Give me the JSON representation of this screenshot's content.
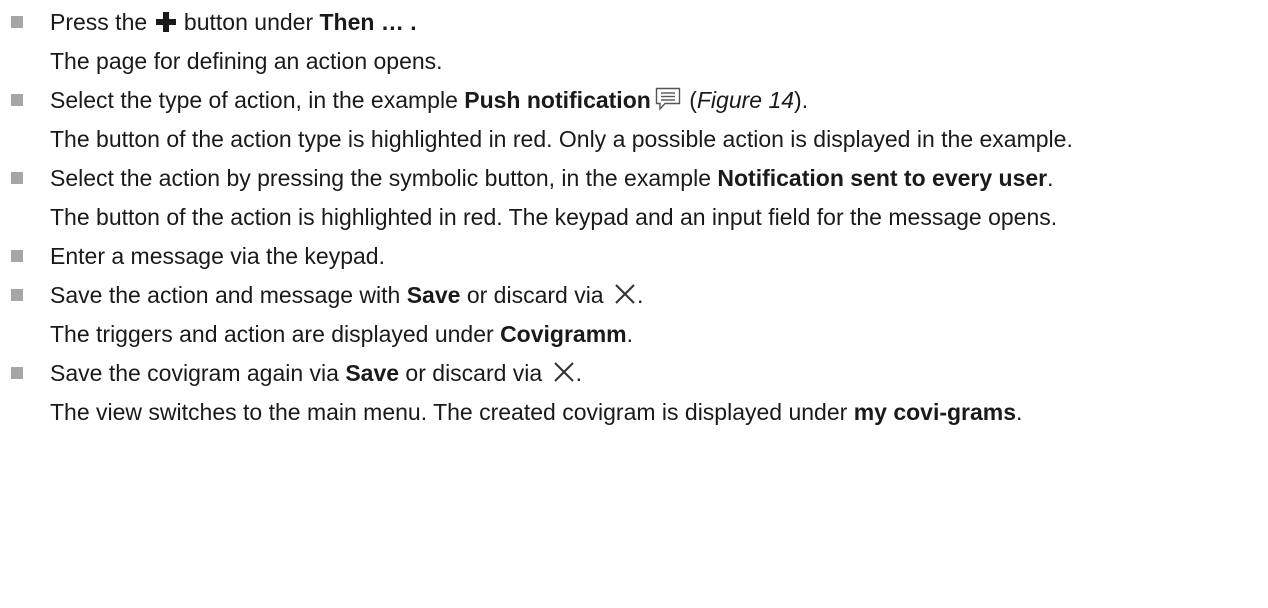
{
  "steps": [
    {
      "instr": {
        "t1": "Press the ",
        "icon": "plus-icon",
        "t2": " button under ",
        "b1": "Then … ."
      },
      "result": "The page for defining an action opens."
    },
    {
      "instr": {
        "t1": "Select the type of action, in the example ",
        "b1": "Push notification",
        "icon": "notification-icon",
        "t2": " (",
        "i1": "Figure 14",
        "t3": ")."
      },
      "result": "The button of the action type is highlighted in red. Only a possible action is displayed in the example."
    },
    {
      "instr": {
        "t1": "Select the action by pressing the symbolic button, in the example ",
        "b1": "Notification sent to every user",
        "t2": "."
      },
      "result": "The button of the action is highlighted in red. The keypad and an input field for the message opens."
    },
    {
      "instr": {
        "t1": "Enter a message via the keypad."
      }
    },
    {
      "instr": {
        "t1": "Save the action and message with ",
        "b1": "Save",
        "t2": " or discard via ",
        "icon": "close-icon",
        "t3": "."
      },
      "result": {
        "t1": "The triggers and action are displayed under ",
        "b1": "Covigramm",
        "t2": "."
      }
    },
    {
      "instr": {
        "t1": "Save the covigram again via ",
        "b1": "Save",
        "t2": " or discard via ",
        "icon": "close-icon",
        "t3": "."
      },
      "result": {
        "t1": "The view switches to the main menu. The created covigram is displayed under ",
        "b1": "my covi-grams",
        "t2": "."
      }
    }
  ],
  "colors": {
    "bullet": "#a6a6a6",
    "text": "#1a1a1a"
  }
}
